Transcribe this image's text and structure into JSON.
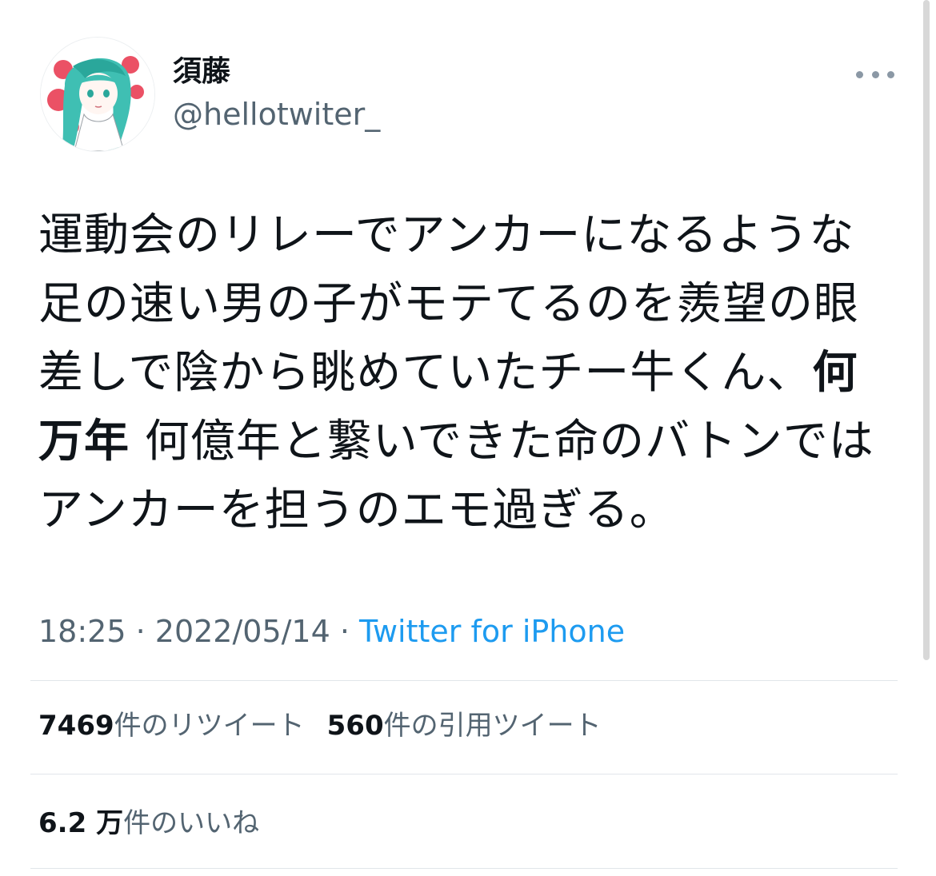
{
  "user": {
    "display_name": "須藤",
    "handle": "@hellotwiter_",
    "avatar_icon": "anime-girl-avatar-icon"
  },
  "menu": {
    "icon": "more-horizontal-icon"
  },
  "tweet": {
    "text_before_bold": "運動会のリレーでアンカーになるような足の速い男の子がモテてるのを羨望の眼差しで陰から眺めていたチー牛くん、",
    "text_bold": "何万年",
    "text_after_bold": " 何億年と繋いできた命のバトンではアンカーを担うのエモ過ぎる。"
  },
  "meta": {
    "time": "18:25",
    "separator1": " · ",
    "date": "2022/05/14",
    "separator2": " · ",
    "source": "Twitter for iPhone"
  },
  "stats": {
    "retweets_count": "7469",
    "retweets_label": "件のリツイート",
    "quotes_count": "560",
    "quotes_label": "件の引用ツイート",
    "likes_count": "6.2 万",
    "likes_label": "件のいいね"
  },
  "colors": {
    "text": "#0f1419",
    "secondary": "#536471",
    "link": "#1d9bf0",
    "divider": "#e1e6ea"
  }
}
